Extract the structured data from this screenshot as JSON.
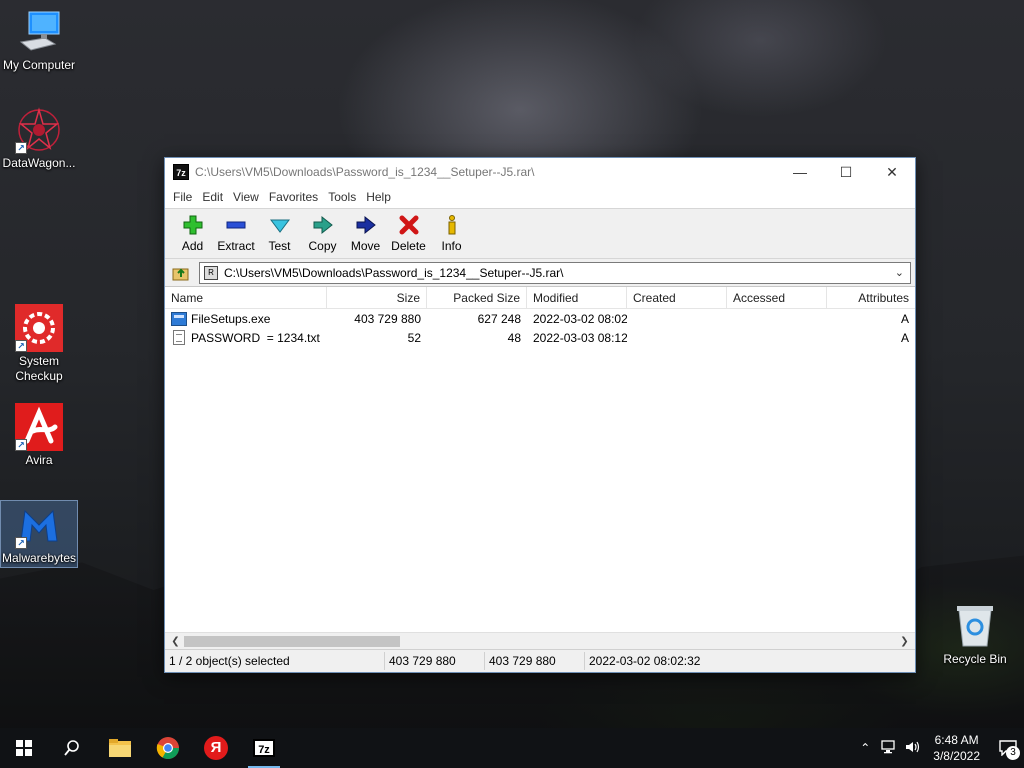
{
  "desktop": {
    "icons": [
      {
        "label": "My Computer"
      },
      {
        "label": "DataWagon..."
      },
      {
        "label": "System Checkup"
      },
      {
        "label": "Avira"
      },
      {
        "label": "Malwarebytes"
      },
      {
        "label": "Recycle Bin"
      }
    ]
  },
  "window": {
    "title": "C:\\Users\\VM5\\Downloads\\Password_is_1234__Setuper--J5.rar\\",
    "app_icon_text": "7z",
    "menu": [
      "File",
      "Edit",
      "View",
      "Favorites",
      "Tools",
      "Help"
    ],
    "toolbar": [
      {
        "label": "Add",
        "icon": "plus-icon"
      },
      {
        "label": "Extract",
        "icon": "minus-icon"
      },
      {
        "label": "Test",
        "icon": "check-icon"
      },
      {
        "label": "Copy",
        "icon": "double-arrow-icon"
      },
      {
        "label": "Move",
        "icon": "arrow-right-icon"
      },
      {
        "label": "Delete",
        "icon": "x-icon"
      },
      {
        "label": "Info",
        "icon": "info-icon"
      }
    ],
    "address": "C:\\Users\\VM5\\Downloads\\Password_is_1234__Setuper--J5.rar\\",
    "columns": [
      "Name",
      "Size",
      "Packed Size",
      "Modified",
      "Created",
      "Accessed",
      "Attributes"
    ],
    "files": [
      {
        "name": "FileSetups.exe",
        "size": "403 729 880",
        "packed": "627 248",
        "modified": "2022-03-02 08:02",
        "created": "",
        "accessed": "",
        "attr": "A"
      },
      {
        "name": "PASSWORD  = 1234.txt",
        "size": "52",
        "packed": "48",
        "modified": "2022-03-03 08:12",
        "created": "",
        "accessed": "",
        "attr": "A"
      }
    ],
    "status": {
      "selected": "1 / 2 object(s) selected",
      "size": "403 729 880",
      "packed": "403 729 880",
      "date": "2022-03-02 08:02:32"
    }
  },
  "taskbar": {
    "clock_time": "6:48 AM",
    "clock_date": "3/8/2022",
    "notif_count": "3",
    "yandex_glyph": "Я",
    "sevenzip_glyph": "7z"
  }
}
